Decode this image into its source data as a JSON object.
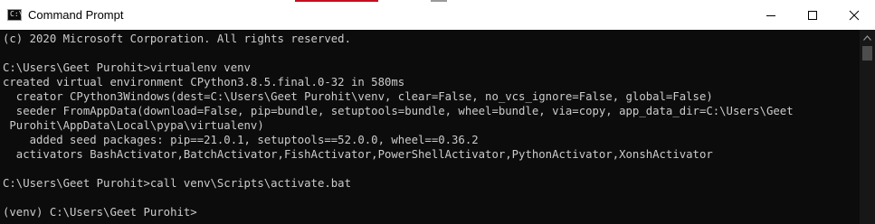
{
  "window": {
    "title": "Command Prompt",
    "icon_label": "C:\\",
    "controls": [
      "minimize-icon",
      "maximize-icon",
      "close-icon"
    ]
  },
  "colors": {
    "background": "#0c0c0c",
    "text": "#cccccc",
    "titlebar": "#ffffff",
    "accent_top": "#c50f1f"
  },
  "terminal": {
    "lines": [
      "(c) 2020 Microsoft Corporation. All rights reserved.",
      "",
      "C:\\Users\\Geet Purohit>virtualenv venv",
      "created virtual environment CPython3.8.5.final.0-32 in 580ms",
      "  creator CPython3Windows(dest=C:\\Users\\Geet Purohit\\venv, clear=False, no_vcs_ignore=False, global=False)",
      "  seeder FromAppData(download=False, pip=bundle, setuptools=bundle, wheel=bundle, via=copy, app_data_dir=C:\\Users\\Geet",
      " Purohit\\AppData\\Local\\pypa\\virtualenv)",
      "    added seed packages: pip==21.0.1, setuptools==52.0.0, wheel==0.36.2",
      "  activators BashActivator,BatchActivator,FishActivator,PowerShellActivator,PythonActivator,XonshActivator",
      "",
      "C:\\Users\\Geet Purohit>call venv\\Scripts\\activate.bat",
      "",
      "(venv) C:\\Users\\Geet Purohit>"
    ]
  }
}
